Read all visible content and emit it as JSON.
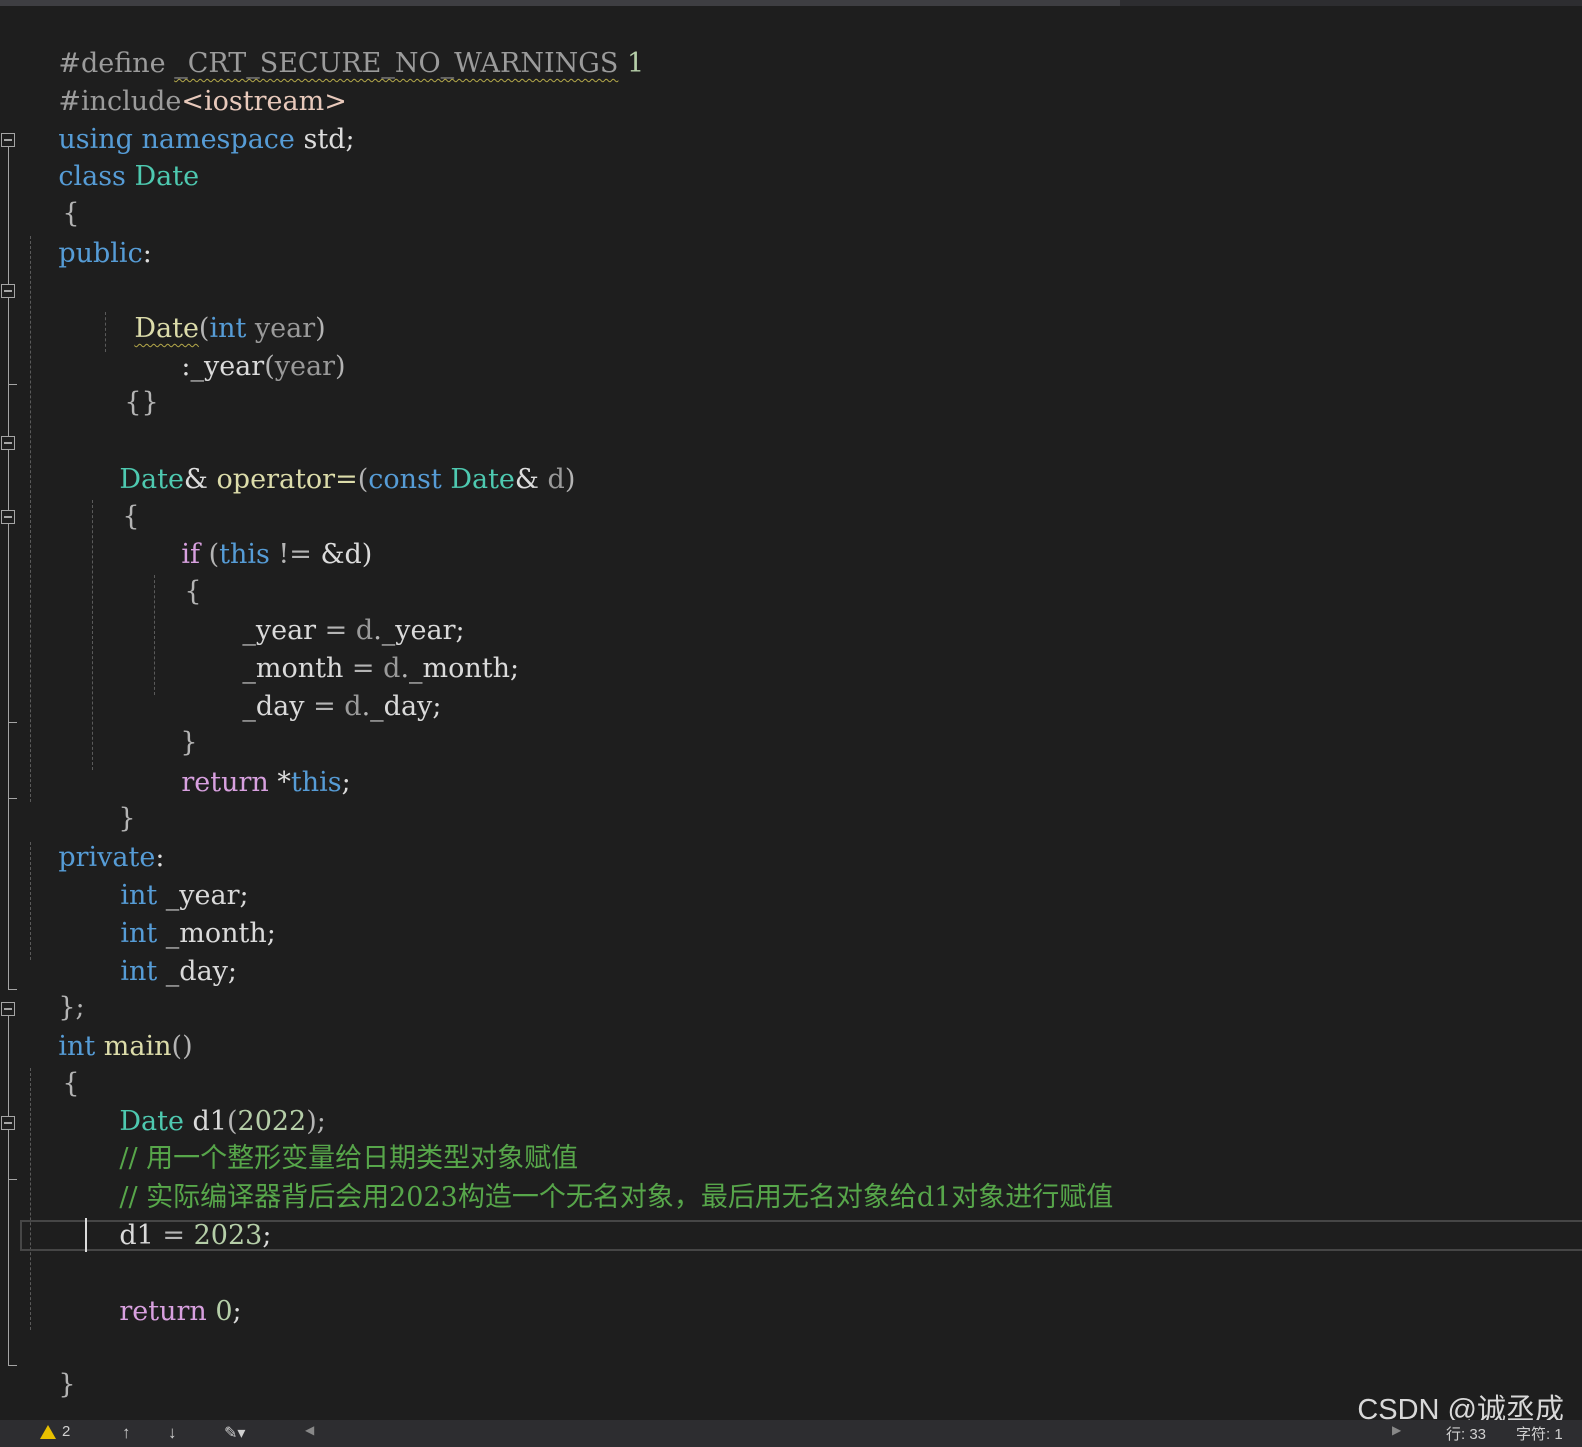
{
  "code": {
    "l1": {
      "pp": "#define ",
      "name": "_CRT_SECURE_NO_WARNINGS",
      "val": " 1"
    },
    "l2": {
      "pp": "#include",
      "path": "<iostream>"
    },
    "l3": {
      "kw1": "using",
      "kw2": " namespace",
      "rest": " std;"
    },
    "l4": {
      "kw": "class",
      "name": " Date"
    },
    "l5": "{",
    "l6": {
      "kw": "public",
      "rest": ":"
    },
    "l8": {
      "fn": "Date",
      "p1": "(",
      "ty": "int",
      "prm": " year",
      "p2": ")"
    },
    "l9": {
      "p1": ":",
      "fld": "_year",
      "p2": "(",
      "prm": "year",
      "p3": ")"
    },
    "l10": "{}",
    "l12": {
      "ty": "Date",
      "op1": "& ",
      "fn": "operator=",
      "p1": "(",
      "kw": "const",
      "ty2": " Date",
      "op2": "&",
      "prm": " d",
      "p2": ")"
    },
    "l13": "{",
    "l14": {
      "ctl": "if",
      "p1": " (",
      "kw": "this",
      "op": " != ",
      "rest": "&d)"
    },
    "l15": "{",
    "l16": {
      "fld1": "_year",
      "op": " = ",
      "prm": "d",
      "dot": ".",
      "fld2": "_year",
      "end": ";"
    },
    "l17": {
      "fld1": "_month",
      "op": " = ",
      "prm": "d",
      "dot": ".",
      "fld2": "_month",
      "end": ";"
    },
    "l18": {
      "fld1": "_day",
      "op": " = ",
      "prm": "d",
      "dot": ".",
      "fld2": "_day",
      "end": ";"
    },
    "l19": "}",
    "l20": {
      "ctl": "return",
      "op": " *",
      "kw": "this",
      "end": ";"
    },
    "l21": "}",
    "l22": {
      "kw": "private",
      "rest": ":"
    },
    "l23": {
      "ty": "int",
      "rest": " _year;"
    },
    "l24": {
      "ty": "int",
      "rest": " _month;"
    },
    "l25": {
      "ty": "int",
      "rest": " _day;"
    },
    "l26": "};",
    "l27": {
      "ty": "int",
      "fn": " main",
      "rest": "()"
    },
    "l28": "{",
    "l29": {
      "ty": "Date",
      "var": " d1",
      "p1": "(",
      "num": "2022",
      "p2": ");"
    },
    "l30": "// 用一个整形变量给日期类型对象赋值",
    "l31": "// 实际编译器背后会用2023构造一个无名对象，最后用无名对象给d1对象进行赋值",
    "l32": {
      "var": "d1",
      "op": " = ",
      "num": "2023",
      "end": ";"
    },
    "l34": {
      "ctl": "return",
      "num": " 0",
      "end": ";"
    },
    "l36": "}"
  },
  "watermark": "CSDN @诚丞成",
  "status_bar": {
    "warning_count": "2",
    "line_label": "行: 33",
    "char_label": "字符: 1"
  },
  "colors": {
    "background": "#1e1e1e",
    "keyword": "#569cd6",
    "type": "#4ec9b0",
    "function": "#dcdcaa",
    "control": "#d8a0df",
    "comment": "#57a64a",
    "number": "#b5cea8",
    "parameter": "#9a9a9a",
    "preprocessor": "#9b9b9b"
  }
}
